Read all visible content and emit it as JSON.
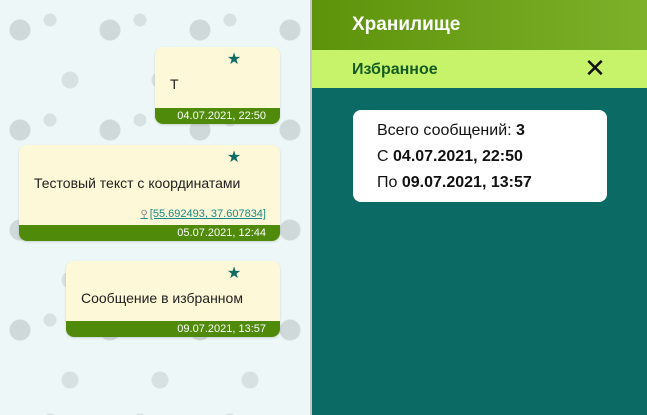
{
  "messages": [
    {
      "text": "Т",
      "date": "04.07.2021, 22:50"
    },
    {
      "text": "Тестовый текст с координатами",
      "coords": "[55.692493, 37.607834]",
      "date": "05.07.2021, 12:44"
    },
    {
      "text": "Сообщение в избранном",
      "date": "09.07.2021, 13:57"
    }
  ],
  "panel": {
    "title": "Хранилище",
    "subtitle": "Избранное",
    "close_icon": "✕",
    "stats": {
      "total_label": "Всего сообщений:",
      "total_value": "3",
      "from_label": "С",
      "from_value": "04.07.2021, 22:50",
      "to_label": "По",
      "to_value": "09.07.2021, 13:57"
    }
  },
  "colors": {
    "panel_bg": "#0b6b64",
    "header_green": "#5d920b",
    "subbar_green": "#c6f36a",
    "bubble_bg": "#fdf8d7",
    "date_bar": "#4f8a0b",
    "star": "#0e6b63"
  }
}
